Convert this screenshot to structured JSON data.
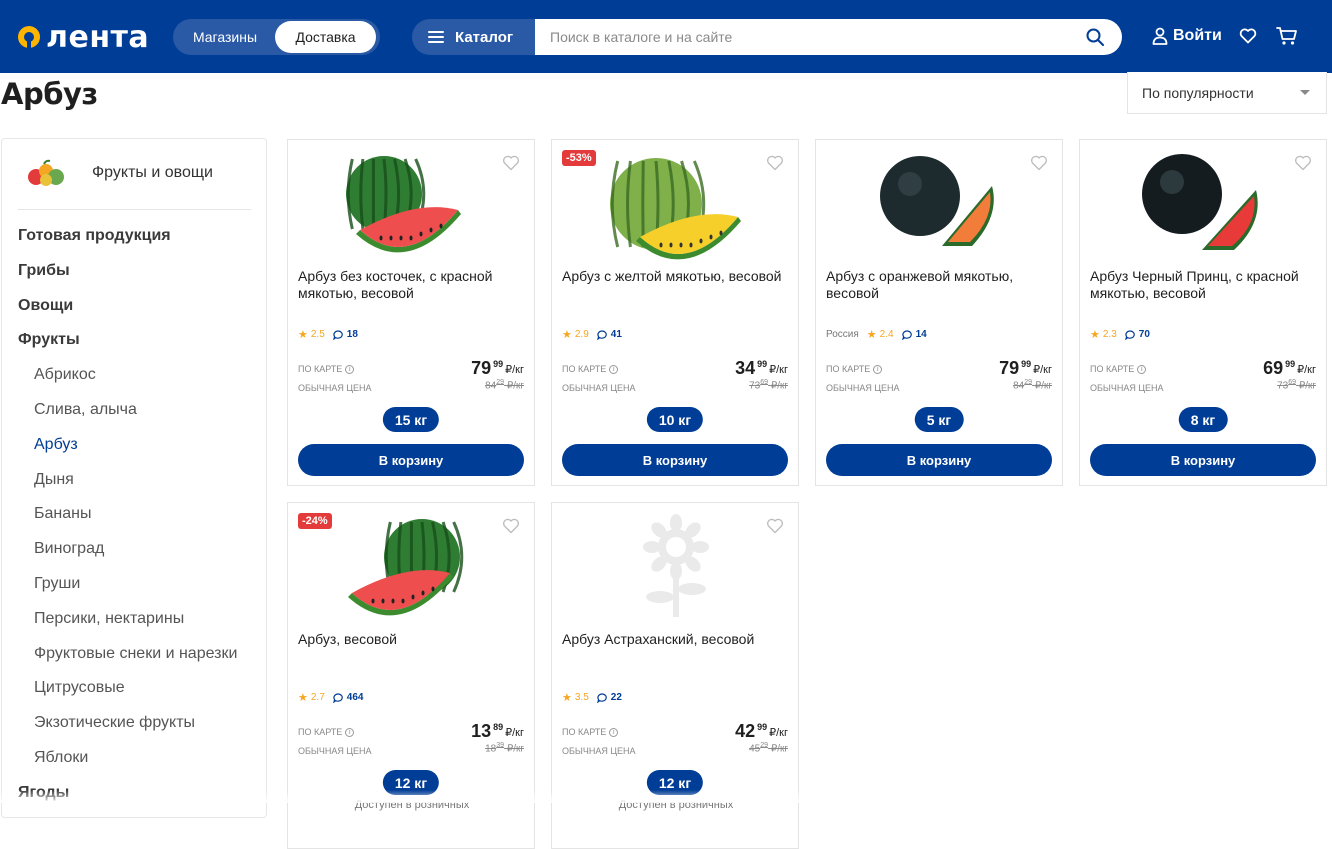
{
  "header": {
    "logo_text": "лента",
    "seg_stores": "Магазины",
    "seg_delivery": "Доставка",
    "catalog_label": "Каталог",
    "search_placeholder": "Поиск в каталоге и на сайте",
    "login_label": "Войти",
    "brand_color": "#003d96"
  },
  "page": {
    "title": "Арбуз",
    "sort_label": "По популярности"
  },
  "sidebar": {
    "category": "Фрукты и овощи",
    "items": [
      {
        "label": "Готовая продукция",
        "level": "main"
      },
      {
        "label": "Грибы",
        "level": "main"
      },
      {
        "label": "Овощи",
        "level": "main"
      },
      {
        "label": "Фрукты",
        "level": "main"
      },
      {
        "label": "Абрикос",
        "level": "sub"
      },
      {
        "label": "Слива, алыча",
        "level": "sub"
      },
      {
        "label": "Арбуз",
        "level": "sub",
        "active": true
      },
      {
        "label": "Дыня",
        "level": "sub"
      },
      {
        "label": "Бананы",
        "level": "sub"
      },
      {
        "label": "Виноград",
        "level": "sub"
      },
      {
        "label": "Груши",
        "level": "sub"
      },
      {
        "label": "Персики, нектарины",
        "level": "sub"
      },
      {
        "label": "Фруктовые снеки и нарезки",
        "level": "sub"
      },
      {
        "label": "Цитрусовые",
        "level": "sub"
      },
      {
        "label": "Экзотические фрукты",
        "level": "sub"
      },
      {
        "label": "Яблоки",
        "level": "sub"
      },
      {
        "label": "Ягоды",
        "level": "main"
      }
    ]
  },
  "labels": {
    "card_price": "ПО КАРТЕ",
    "regular_price": "ОБЫЧНАЯ ЦЕНА",
    "to_cart": "В корзину",
    "unit": "₽/кг",
    "available": "Доступен в розничных"
  },
  "products": [
    {
      "name": "Арбуз без косточек, с красной мякотью, весовой",
      "badge": "",
      "origin": "",
      "rating": "2.5",
      "reviews": "18",
      "price_rub": "79",
      "price_kop": "99",
      "old_rub": "84",
      "old_kop": "29",
      "weight": "15 кг",
      "image": "watermelon-red",
      "action": "cart"
    },
    {
      "name": "Арбуз с желтой мякотью, весовой",
      "badge": "-53%",
      "origin": "",
      "rating": "2.9",
      "reviews": "41",
      "price_rub": "34",
      "price_kop": "99",
      "old_rub": "73",
      "old_kop": "69",
      "weight": "10 кг",
      "image": "watermelon-yellow",
      "action": "cart"
    },
    {
      "name": "Арбуз с оранжевой мякотью, весовой",
      "badge": "",
      "origin": "Россия",
      "rating": "2.4",
      "reviews": "14",
      "price_rub": "79",
      "price_kop": "99",
      "old_rub": "84",
      "old_kop": "29",
      "weight": "5 кг",
      "image": "watermelon-orange",
      "action": "cart"
    },
    {
      "name": "Арбуз Черный Принц, с красной мякотью, весовой",
      "badge": "",
      "origin": "",
      "rating": "2.3",
      "reviews": "70",
      "price_rub": "69",
      "price_kop": "99",
      "old_rub": "73",
      "old_kop": "69",
      "weight": "8 кг",
      "image": "watermelon-black",
      "action": "cart"
    },
    {
      "name": "Арбуз, весовой",
      "badge": "-24%",
      "origin": "",
      "rating": "2.7",
      "reviews": "464",
      "price_rub": "13",
      "price_kop": "89",
      "old_rub": "18",
      "old_kop": "39",
      "weight": "12 кг",
      "image": "watermelon-red-2",
      "action": "available"
    },
    {
      "name": "Арбуз Астраханский, весовой",
      "badge": "",
      "origin": "",
      "rating": "3.5",
      "reviews": "22",
      "price_rub": "42",
      "price_kop": "99",
      "old_rub": "45",
      "old_kop": "29",
      "weight": "12 кг",
      "image": "placeholder-flower",
      "action": "available"
    }
  ]
}
